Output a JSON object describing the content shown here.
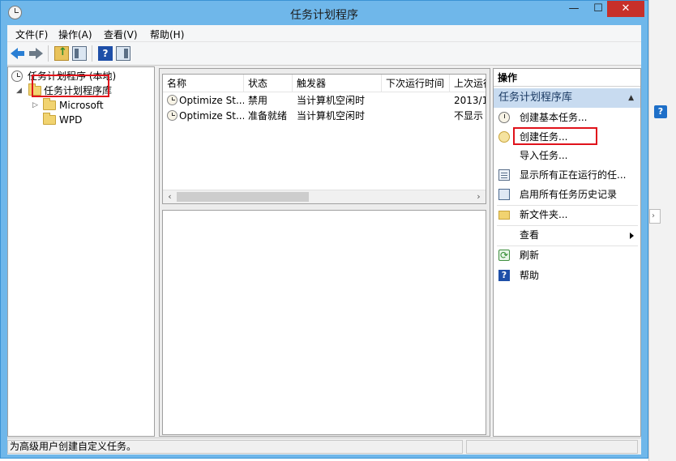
{
  "window": {
    "title": "任务计划程序",
    "controls": {
      "minimize": "—",
      "maximize": "☐",
      "close": "✕"
    }
  },
  "menubar": {
    "items": [
      {
        "label": "文件(F)"
      },
      {
        "label": "操作(A)"
      },
      {
        "label": "查看(V)"
      },
      {
        "label": "帮助(H)"
      }
    ]
  },
  "toolbar": {
    "icons": [
      "back-arrow-icon",
      "forward-arrow-icon",
      "up-folder-icon",
      "show-hide-tree-icon",
      "help-icon",
      "show-hide-action-pane-icon"
    ],
    "help_glyph": "?"
  },
  "tree": {
    "root": {
      "label": "任务计划程序 (本地)"
    },
    "library": {
      "label": "任务计划程序库"
    },
    "children": [
      {
        "label": "Microsoft"
      },
      {
        "label": "WPD"
      }
    ]
  },
  "task_list": {
    "columns": [
      "名称",
      "状态",
      "触发器",
      "下次运行时间",
      "上次运行"
    ],
    "rows": [
      {
        "name": "Optimize St...",
        "status": "禁用",
        "trigger": "当计算机空闲时",
        "next_run": "",
        "last_run": "2013/1"
      },
      {
        "name": "Optimize St...",
        "status": "准备就绪",
        "trigger": "当计算机空闲时",
        "next_run": "",
        "last_run": "不显示"
      }
    ],
    "scroll_left": "‹",
    "scroll_right": "›"
  },
  "actions": {
    "header": "操作",
    "section_title": "任务计划程序库",
    "section_caret": "▲",
    "items": [
      {
        "label": "创建基本任务...",
        "icon": "clock-wizard-icon"
      },
      {
        "label": "创建任务...",
        "icon": "create-task-icon"
      },
      {
        "label": "导入任务...",
        "icon": ""
      },
      {
        "label": "显示所有正在运行的任...",
        "icon": "running-tasks-icon"
      },
      {
        "label": "启用所有任务历史记录",
        "icon": "history-icon"
      },
      {
        "label": "新文件夹...",
        "icon": "new-folder-icon"
      },
      {
        "label": "查看",
        "icon": ""
      },
      {
        "label": "刷新",
        "icon": "refresh-icon"
      },
      {
        "label": "帮助",
        "icon": "help-icon"
      }
    ]
  },
  "status": {
    "text": "为高级用户创建自定义任务。"
  },
  "highlight_color": "#e0121b"
}
